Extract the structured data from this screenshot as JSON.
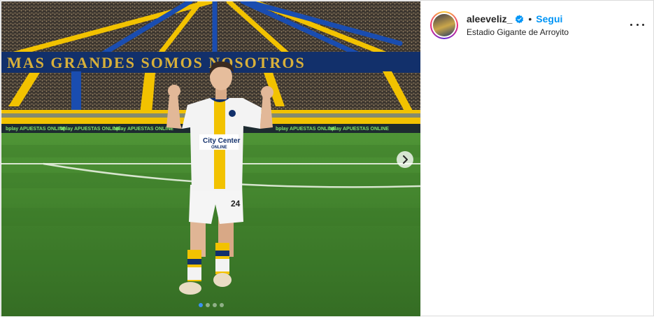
{
  "post": {
    "username": "aleeveliz_",
    "verified": true,
    "follow_label": "Segui",
    "separator": "•",
    "location": "Estadio Gigante de Arroyito"
  },
  "media": {
    "banner_text": "MAS GRANDES SOMOS NOSOTROS",
    "ad_board_text": "bplay APUESTAS ONLINE",
    "jersey_sponsor": "City Center",
    "jersey_sponsor_sub": "ONLINE",
    "shorts_number": "24",
    "carousel_total": 4,
    "carousel_active": 1
  },
  "icons": {
    "next": "chevron-right-icon",
    "more": "more-options-icon",
    "verified": "verified-badge-icon"
  },
  "colors": {
    "follow": "#0095f6",
    "verified": "#0095f6",
    "club_yellow": "#f2c200",
    "club_blue": "#12306b",
    "pitch": "#4a8a35"
  }
}
